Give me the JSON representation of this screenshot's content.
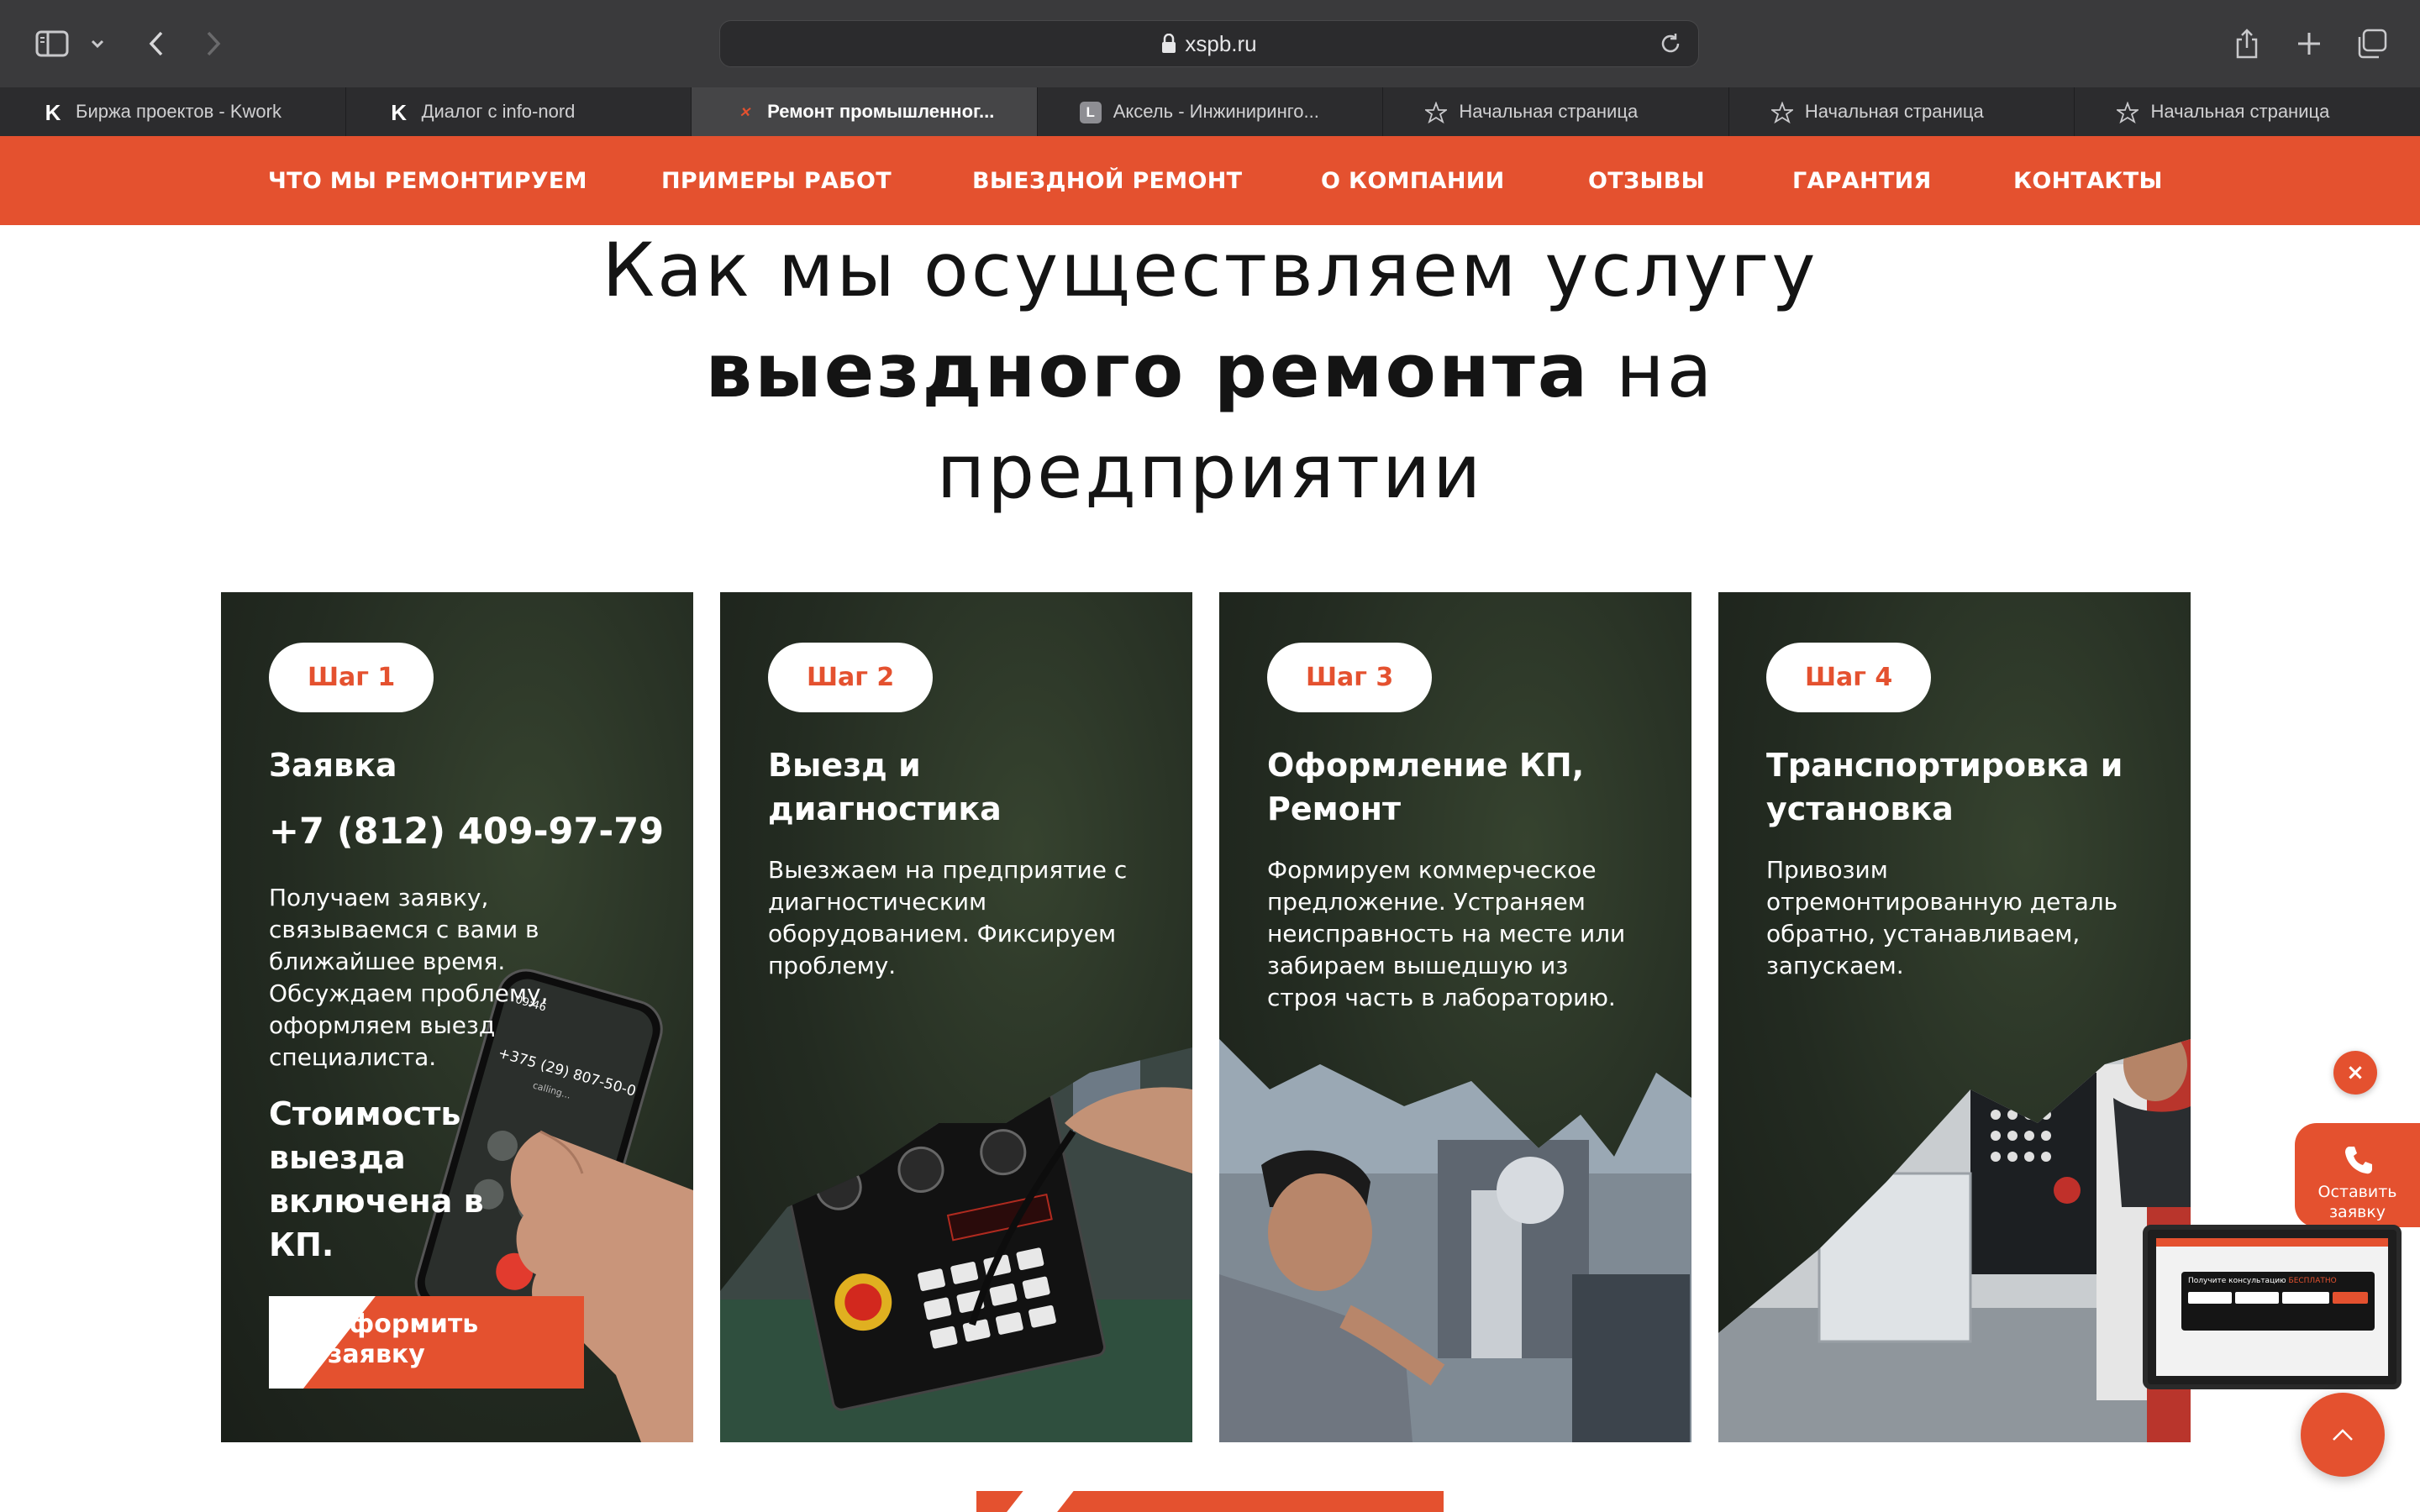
{
  "browser": {
    "url": "xspb.ru",
    "tabs": [
      {
        "label": "Биржа проектов - Kwork",
        "favicon": "kwork-icon",
        "active": false
      },
      {
        "label": "Диалог с info-nord",
        "favicon": "kwork-icon",
        "active": false
      },
      {
        "label": "Ремонт промышленног...",
        "favicon": "xspb-icon",
        "active": true
      },
      {
        "label": "Аксель - Инжиниринго...",
        "favicon": "letter-l-icon",
        "favicon_letter": "L",
        "active": false
      },
      {
        "label": "Начальная страница",
        "favicon": "star-icon",
        "active": false
      },
      {
        "label": "Начальная страница",
        "favicon": "star-icon",
        "active": false
      },
      {
        "label": "Начальная страница",
        "favicon": "star-icon",
        "active": false
      }
    ]
  },
  "nav": {
    "items": [
      "ЧТО МЫ РЕМОНТИРУЕМ",
      "ПРИМЕРЫ РАБОТ",
      "ВЫЕЗДНОЙ РЕМОНТ",
      "О КОМПАНИИ",
      "ОТЗЫВЫ",
      "ГАРАНТИЯ",
      "КОНТАКТЫ"
    ]
  },
  "heading": {
    "line1": "Как мы осуществляем услугу",
    "line2_bold": "выездного ремонта",
    "line2_rest": "на",
    "line3": "предприятии"
  },
  "steps": [
    {
      "badge": "Шаг 1",
      "title": "Заявка",
      "phone": "+7 (812) 409-97-79",
      "text": "Получаем заявку, связываемся с вами в ближайшее время. Обсуждаем проблему, оформляем выезд специалиста.",
      "cost": "Стоимость выезда включена в КП.",
      "button": "Оформить заявку",
      "phone_screen_number": "+375 (29) 807-50-0"
    },
    {
      "badge": "Шаг 2",
      "title": "Выезд и диагностика",
      "text": "Выезжаем на предприятие с диагностическим оборудованием. Фиксируем проблему."
    },
    {
      "badge": "Шаг 3",
      "title": "Оформление КП, Ремонт",
      "text": "Формируем коммерческое предложение. Устраняем неисправность на месте или забираем вышедшую из строя часть в лабораторию."
    },
    {
      "badge": "Шаг 4",
      "title": "Транспортировка и установка",
      "text": "Привозим отремонтированную деталь обратно, устанавливаем, запускаем."
    }
  ],
  "widgets": {
    "close": "×",
    "callback": "Оставить заявку",
    "laptop_title_plain": "Получите консультацию",
    "laptop_title_accent": "БЕСПЛАТНО"
  },
  "colors": {
    "accent": "#e4512f",
    "card_bg": "#232b21",
    "chrome": "#3a3a3c"
  }
}
